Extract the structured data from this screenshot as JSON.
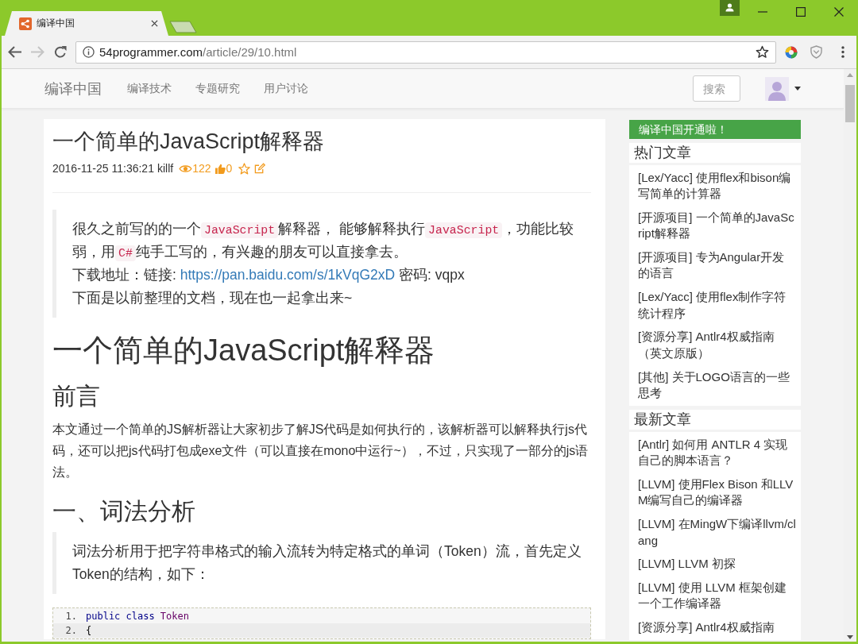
{
  "browser": {
    "tabs": [
      {
        "title": "编译中国",
        "selected": true
      }
    ],
    "nav_buttons": [
      {
        "kind": "back",
        "disabled": false
      },
      {
        "kind": "forward",
        "disabled": true
      },
      {
        "kind": "reload",
        "disabled": false
      }
    ],
    "address": {
      "host": "54programmer.com",
      "path": "/article/29/10.html"
    }
  },
  "navbar": {
    "brand": "编译中国",
    "links": [
      {
        "label": "编译技术"
      },
      {
        "label": "专题研究"
      },
      {
        "label": "用户讨论"
      }
    ],
    "search": {
      "placeholder": "搜索"
    }
  },
  "article": {
    "title": "一个简单的JavaScript解释器",
    "meta": {
      "date": "2016-11-25 11:36:21",
      "author": "killf",
      "views": "122",
      "likes": "0"
    },
    "blocks": [
      {
        "kind": "quote",
        "paragraphs": [
          {
            "parts": [
              {
                "kind": "text",
                "text": "很久之前写的的一个"
              },
              {
                "kind": "code",
                "text": "JavaScript"
              },
              {
                "kind": "text",
                "text": "解释器， 能够解释执行"
              },
              {
                "kind": "code",
                "text": "JavaScript"
              },
              {
                "kind": "text",
                "text": "，功能比较弱，用"
              },
              {
                "kind": "code",
                "text": "C#"
              },
              {
                "kind": "text",
                "text": "纯手工写的，有兴趣的朋友可以直接拿去。"
              }
            ]
          },
          {
            "parts": [
              {
                "kind": "text",
                "text": "下载地址：链接: "
              },
              {
                "kind": "link",
                "text": "https://pan.baidu.com/s/1kVqG2xD"
              },
              {
                "kind": "text",
                "text": " 密码: vqpx"
              }
            ]
          },
          {
            "parts": [
              {
                "kind": "text",
                "text": "下面是以前整理的文档，现在也一起拿出来~"
              }
            ]
          }
        ]
      },
      {
        "kind": "h1",
        "text": "一个简单的JavaScript解释器"
      },
      {
        "kind": "h2",
        "text": "前言"
      },
      {
        "kind": "paragraph",
        "text": "本文通过一个简单的JS解析器让大家初步了解JS代码是如何执行的，该解析器可以解释执行js代码，还可以把js代码打包成exe文件（可以直接在mono中运行~），不过，只实现了一部分的js语法。"
      },
      {
        "kind": "h2",
        "text": "一、词法分析"
      },
      {
        "kind": "quote",
        "paragraphs": [
          {
            "parts": [
              {
                "kind": "text",
                "text": "词法分析用于把字符串格式的输入流转为特定格式的单词（Token）流，首先定义Token的结构，如下："
              }
            ]
          }
        ]
      },
      {
        "kind": "code",
        "lines": [
          {
            "number": "1.",
            "tokens": [
              {
                "kind": "keyword",
                "text": "public"
              },
              {
                "kind": "keyword",
                "text": "class"
              },
              {
                "kind": "type",
                "text": "Token"
              }
            ]
          },
          {
            "number": "2.",
            "tokens": [
              {
                "kind": "plain",
                "text": "{"
              }
            ]
          }
        ]
      }
    ]
  },
  "sidebar": {
    "notice": "编译中国开通啦！",
    "panels": [
      {
        "heading": "热门文章",
        "items": [
          "[Lex/Yacc] 使用flex和bison编写简单的计算器",
          "[开源项目] 一个简单的JavaScript解释器",
          "[开源项目] 专为Angular开发的语言",
          "[Lex/Yacc] 使用flex制作字符统计程序",
          "[资源分享] Antlr4权威指南（英文原版）",
          "[其他] 关于LOGO语言的一些思考"
        ]
      },
      {
        "heading": "最新文章",
        "items": [
          "[Antlr] 如何用 ANTLR 4 实现自己的脚本语言？",
          "[LLVM] 使用Flex Bison 和LLVM编写自己的编译器",
          "[LLVM] 在MingW下编译llvm/clang",
          "[LLVM] LLVM 初探",
          "[LLVM] 使用 LLVM 框架创建一个工作编译器",
          "[资源分享] Antlr4权威指南"
        ]
      }
    ]
  }
}
